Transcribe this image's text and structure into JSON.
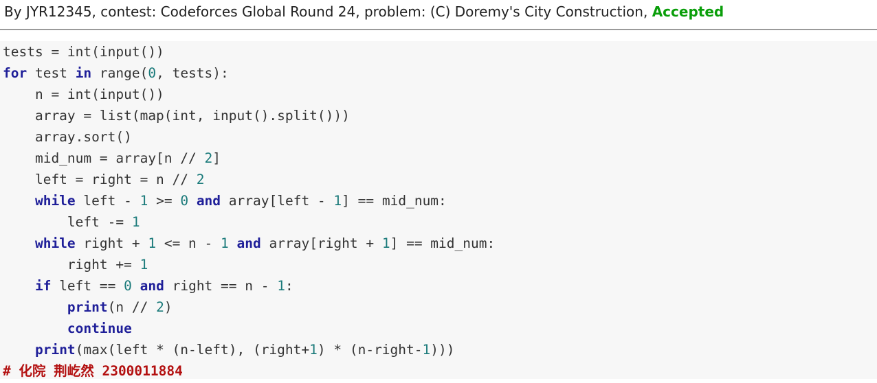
{
  "header": {
    "prefix": "By JYR12345, contest: Codeforces Global Round 24, problem: (C) Doremy's City Construction, ",
    "verdict": "Accepted"
  },
  "code": {
    "lines": [
      "tests = int(input())",
      "for test in range(0, tests):",
      "    n = int(input())",
      "    array = list(map(int, input().split()))",
      "    array.sort()",
      "    mid_num = array[n // 2]",
      "    left = right = n // 2",
      "    while left - 1 >= 0 and array[left - 1] == mid_num:",
      "        left -= 1",
      "    while right + 1 <= n - 1 and array[right + 1] == mid_num:",
      "        right += 1",
      "    if left == 0 and right == n - 1:",
      "        print(n // 2)",
      "        continue",
      "    print(max(left * (n-left), (right+1) * (n-right-1)))",
      "# 化院 荆屹然 2300011884"
    ]
  },
  "colors": {
    "keyword": "#1f1f99",
    "number": "#1a7a7a",
    "comment": "#b31010",
    "accepted": "#0a9e0a"
  }
}
